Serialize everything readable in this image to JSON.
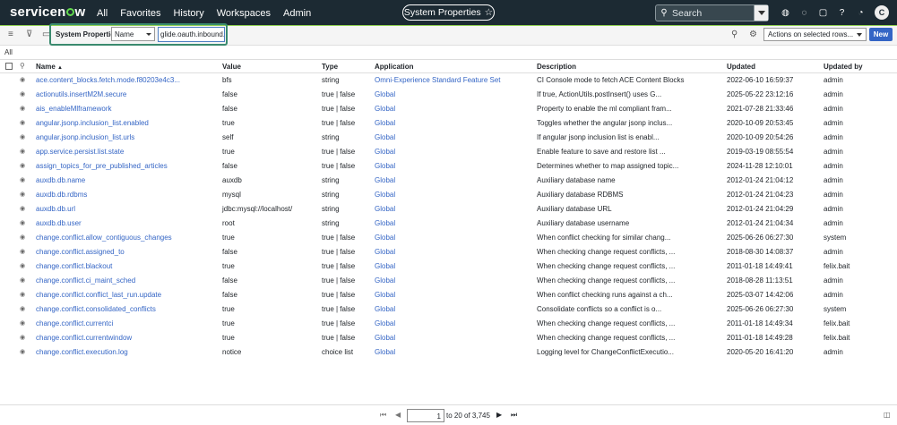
{
  "nav": {
    "logo": "servicenow",
    "menu": [
      "All",
      "Favorites",
      "History",
      "Workspaces",
      "Admin"
    ],
    "pill": "System Properties",
    "search_placeholder": "Search",
    "avatar_initial": "C"
  },
  "toolbar": {
    "title": "System Properties",
    "field_select": "Name",
    "filter_value": "glide.oauth.inbound.cl",
    "actions_select": "Actions on selected rows...",
    "new_button": "New"
  },
  "breadcrumb": "All",
  "table": {
    "columns": [
      "Name",
      "Value",
      "Type",
      "Application",
      "Description",
      "Updated",
      "Updated by"
    ],
    "sort_indicator": "▲",
    "rows": [
      [
        "ace.content_blocks.fetch.mode.f80203e4c3...",
        "bfs",
        "string",
        "Omni-Experience Standard Feature Set",
        "CI Console mode to fetch ACE Content Blocks",
        "2022-06-10 16:59:37",
        "admin"
      ],
      [
        "actionutils.insertM2M.secure",
        "false",
        "true | false",
        "Global",
        "If true, ActionUtils.postInsert() uses G...",
        "2025-05-22 23:12:16",
        "admin"
      ],
      [
        "ais_enableMlframework",
        "false",
        "true | false",
        "Global",
        "Property to enable the ml compliant fram...",
        "2021-07-28 21:33:46",
        "admin"
      ],
      [
        "angular.jsonp.inclusion_list.enabled",
        "true",
        "true | false",
        "Global",
        "Toggles whether the angular jsonp inclus...",
        "2020-10-09 20:53:45",
        "admin"
      ],
      [
        "angular.jsonp.inclusion_list.urls",
        "self",
        "string",
        "Global",
        "If angular jsonp inclusion list is enabl...",
        "2020-10-09 20:54:26",
        "admin"
      ],
      [
        "app.service.persist.list.state",
        "true",
        "true | false",
        "Global",
        "Enable feature to save and restore list ...",
        "2019-03-19 08:55:54",
        "admin"
      ],
      [
        "assign_topics_for_pre_published_articles",
        "false",
        "true | false",
        "Global",
        "Determines whether to map assigned topic...",
        "2024-11-28 12:10:01",
        "admin"
      ],
      [
        "auxdb.db.name",
        "auxdb",
        "string",
        "Global",
        "Auxiliary database name",
        "2012-01-24 21:04:12",
        "admin"
      ],
      [
        "auxdb.db.rdbms",
        "mysql",
        "string",
        "Global",
        "Auxiliary database RDBMS",
        "2012-01-24 21:04:23",
        "admin"
      ],
      [
        "auxdb.db.url",
        "jdbc:mysql://localhost/",
        "string",
        "Global",
        "Auxiliary database URL",
        "2012-01-24 21:04:29",
        "admin"
      ],
      [
        "auxdb.db.user",
        "root",
        "string",
        "Global",
        "Auxiliary database username",
        "2012-01-24 21:04:34",
        "admin"
      ],
      [
        "change.conflict.allow_contiguous_changes",
        "true",
        "true | false",
        "Global",
        "When conflict checking for similar chang...",
        "2025-06-26 06:27:30",
        "system"
      ],
      [
        "change.conflict.assigned_to",
        "false",
        "true | false",
        "Global",
        "When checking change request conflicts, ...",
        "2018-08-30 14:08:37",
        "admin"
      ],
      [
        "change.conflict.blackout",
        "true",
        "true | false",
        "Global",
        "When checking change request conflicts, ...",
        "2011-01-18 14:49:41",
        "felix.bait"
      ],
      [
        "change.conflict.ci_maint_sched",
        "false",
        "true | false",
        "Global",
        "When checking change request conflicts, ...",
        "2018-08-28 11:13:51",
        "admin"
      ],
      [
        "change.conflict.conflict_last_run.update",
        "false",
        "true | false",
        "Global",
        "When conflict checking runs against a ch...",
        "2025-03-07 14:42:06",
        "admin"
      ],
      [
        "change.conflict.consolidated_conflicts",
        "true",
        "true | false",
        "Global",
        "Consolidate conflicts so a conflict is o...",
        "2025-06-26 06:27:30",
        "system"
      ],
      [
        "change.conflict.currentci",
        "true",
        "true | false",
        "Global",
        "When checking change request conflicts, ...",
        "2011-01-18 14:49:34",
        "felix.bait"
      ],
      [
        "change.conflict.currentwindow",
        "true",
        "true | false",
        "Global",
        "When checking change request conflicts, ...",
        "2011-01-18 14:49:28",
        "felix.bait"
      ],
      [
        "change.conflict.execution.log",
        "notice",
        "choice list",
        "Global",
        "Logging level for ChangeConflictExecutio...",
        "2020-05-20 16:41:20",
        "admin"
      ]
    ]
  },
  "pagination": {
    "current": "1",
    "text": "to 20 of 3,745"
  }
}
